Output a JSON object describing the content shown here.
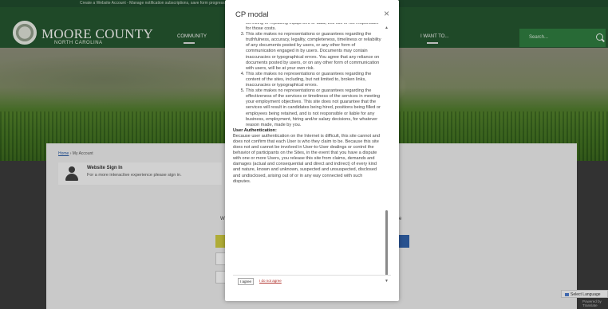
{
  "notice": {
    "text": "Create a Website Account - Manage notification subscriptions, save form progress and more."
  },
  "header": {
    "brand_name": "MOORE COUNTY",
    "brand_sub": "NORTH CAROLINA",
    "nav": [
      "COMMUNITY",
      "I WANT TO..."
    ],
    "search_placeholder": "Search..."
  },
  "breadcrumb": {
    "home": "Home",
    "separator": "›",
    "current": "My Account"
  },
  "signin": {
    "title": "Website Sign In",
    "description": "For a more interactive experience please sign in."
  },
  "background_text": {
    "left_letter": "W",
    "right_letter": "e"
  },
  "language": {
    "label": "Select Language",
    "powered": "Powered by Translate"
  },
  "modal": {
    "title": "CP modal",
    "close_symbol": "×",
    "terms": {
      "item1_tail": "servicing or replacing equipment or data, this site is not responsible for those costs.",
      "items": [
        "This site makes no representations or guarantees regarding the truthfulness, accuracy, legality, completeness, timeliness or reliability of any documents posted by users, or any other form of communication engaged in by users. Documents may contain inaccuracies or typographical errors. You agree that any reliance on documents posted by users, or on any other form of communication with users, will be at your own risk.",
        "This site makes no representations or guarantees regarding the content of the sites, including, but not limited to, broken links, inaccuracies or typographical errors.",
        "This site makes no representations or guarantees regarding the effectiveness of the services or timeliness of the services in meeting your employment objectives. This site does not guarantee that the services will result in candidates being hired, positions being filled or employees being retained, and is not responsible or liable for any business, employment, hiring and/or salary decisions, for whatever reason made, made by you."
      ],
      "section_heading": "User Authentication:",
      "section_text": "Because user authentication on the Internet is difficult, this site cannot and does not confirm that each User is who they claim to be. Because this site does not and cannot be involved in User-to-User dealings or control the behavior of participants on the Sites, in the event that you have a dispute with one or more Users, you release this site from claims, demands and damages (actual and consequential and direct and indirect) of every kind and nature, known and unknown, suspected and unsuspected, disclosed and undisclosed, arising out of or in any way connected with such disputes."
    },
    "agree_label": "I agree",
    "disagree_label": "I do not agree"
  }
}
